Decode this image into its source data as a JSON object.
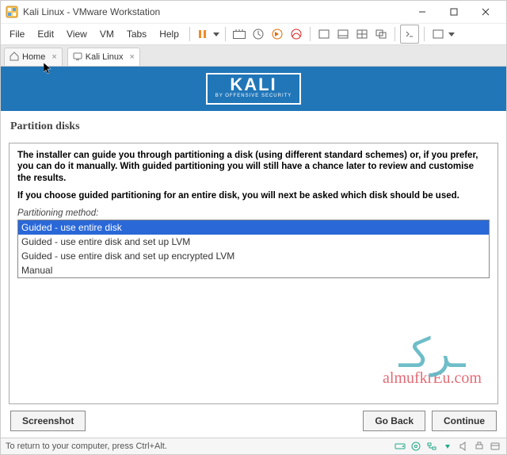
{
  "titlebar": {
    "title": "Kali Linux - VMware Workstation"
  },
  "menu": {
    "file": "File",
    "edit": "Edit",
    "view": "View",
    "vm": "VM",
    "tabs": "Tabs",
    "help": "Help"
  },
  "tabs": {
    "home": "Home",
    "kali": "Kali Linux"
  },
  "banner": {
    "logo_big": "KALI",
    "logo_small": "BY OFFENSIVE SECURITY"
  },
  "page": {
    "title": "Partition disks",
    "para1": "The installer can guide you through partitioning a disk (using different standard schemes) or, if you prefer, you can do it manually. With guided partitioning you will still have a chance later to review and customise the results.",
    "para2": "If you choose guided partitioning for an entire disk, you will next be asked which disk should be used.",
    "method_label": "Partitioning method:",
    "options": [
      "Guided - use entire disk",
      "Guided - use entire disk and set up LVM",
      "Guided - use entire disk and set up encrypted LVM",
      "Manual"
    ]
  },
  "watermark": {
    "url": "almufkrEu.com"
  },
  "buttons": {
    "screenshot": "Screenshot",
    "goback": "Go Back",
    "continue": "Continue"
  },
  "status": {
    "hint": "To return to your computer, press Ctrl+Alt."
  }
}
